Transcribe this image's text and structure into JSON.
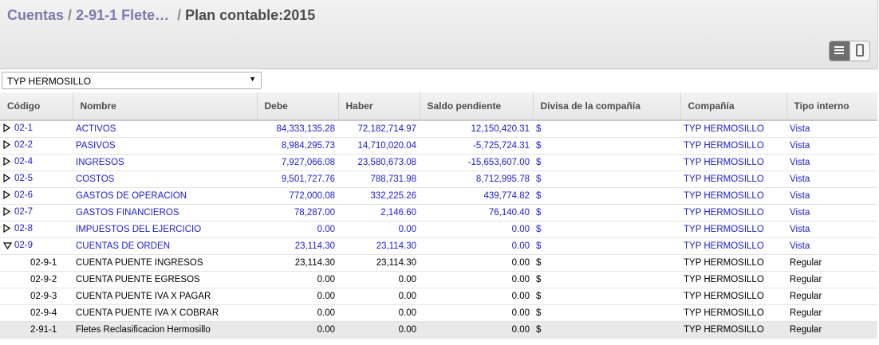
{
  "breadcrumb": {
    "item1": "Cuentas",
    "sep1": "/",
    "item2": "2-91-1 Flete…",
    "sep2": "/",
    "current": "Plan contable:2015"
  },
  "view_switch": {
    "active": "list-view-icon",
    "other": "form-view-icon"
  },
  "company_select": {
    "value": "TYP HERMOSILLO"
  },
  "columns": [
    "Código",
    "Nombre",
    "Debe",
    "Haber",
    "Saldo pendiente",
    "Divisa de la compañía",
    "Compañía",
    "Tipo interno"
  ],
  "rows": [
    {
      "code": "02-1",
      "name": "ACTIVOS",
      "debe": "84,333,135.28",
      "haber": "72,182,714.97",
      "saldo": "12,150,420.31",
      "currency": "$",
      "company": "TYP HERMOSILLO",
      "type": "Vista",
      "expander": "collapsed"
    },
    {
      "code": "02-2",
      "name": "PASIVOS",
      "debe": "8,984,295.73",
      "haber": "14,710,020.04",
      "saldo": "-5,725,724.31",
      "currency": "$",
      "company": "TYP HERMOSILLO",
      "type": "Vista",
      "expander": "collapsed"
    },
    {
      "code": "02-4",
      "name": "INGRESOS",
      "debe": "7,927,066.08",
      "haber": "23,580,673.08",
      "saldo": "-15,653,607.00",
      "currency": "$",
      "company": "TYP HERMOSILLO",
      "type": "Vista",
      "expander": "collapsed"
    },
    {
      "code": "02-5",
      "name": "COSTOS",
      "debe": "9,501,727.76",
      "haber": "788,731.98",
      "saldo": "8,712,995.78",
      "currency": "$",
      "company": "TYP HERMOSILLO",
      "type": "Vista",
      "expander": "collapsed"
    },
    {
      "code": "02-6",
      "name": "GASTOS DE OPERACION",
      "debe": "772,000.08",
      "haber": "332,225.26",
      "saldo": "439,774.82",
      "currency": "$",
      "company": "TYP HERMOSILLO",
      "type": "Vista",
      "expander": "collapsed"
    },
    {
      "code": "02-7",
      "name": "GASTOS FINANCIEROS",
      "debe": "78,287.00",
      "haber": "2,146.60",
      "saldo": "76,140.40",
      "currency": "$",
      "company": "TYP HERMOSILLO",
      "type": "Vista",
      "expander": "collapsed"
    },
    {
      "code": "02-8",
      "name": "IMPUESTOS DEL EJERCICIO",
      "debe": "0.00",
      "haber": "0.00",
      "saldo": "0.00",
      "currency": "$",
      "company": "TYP HERMOSILLO",
      "type": "Vista",
      "expander": "collapsed"
    },
    {
      "code": "02-9",
      "name": "CUENTAS DE ORDEN",
      "debe": "23,114.30",
      "haber": "23,114.30",
      "saldo": "0.00",
      "currency": "$",
      "company": "TYP HERMOSILLO",
      "type": "Vista",
      "expander": "expanded"
    },
    {
      "code": "02-9-1",
      "name": "CUENTA PUENTE INGRESOS",
      "debe": "23,114.30",
      "haber": "23,114.30",
      "saldo": "0.00",
      "currency": "$",
      "company": "TYP HERMOSILLO",
      "type": "Regular",
      "expander": "none"
    },
    {
      "code": "02-9-2",
      "name": "CUENTA PUENTE EGRESOS",
      "debe": "0.00",
      "haber": "0.00",
      "saldo": "0.00",
      "currency": "$",
      "company": "TYP HERMOSILLO",
      "type": "Regular",
      "expander": "none"
    },
    {
      "code": "02-9-3",
      "name": "CUENTA PUENTE IVA X PAGAR",
      "debe": "0.00",
      "haber": "0.00",
      "saldo": "0.00",
      "currency": "$",
      "company": "TYP HERMOSILLO",
      "type": "Regular",
      "expander": "none"
    },
    {
      "code": "02-9-4",
      "name": "CUENTA PUENTE IVA X COBRAR",
      "debe": "0.00",
      "haber": "0.00",
      "saldo": "0.00",
      "currency": "$",
      "company": "TYP HERMOSILLO",
      "type": "Regular",
      "expander": "none"
    },
    {
      "code": "2-91-1",
      "name": "Fletes Reclasificacion Hermosillo",
      "debe": "0.00",
      "haber": "0.00",
      "saldo": "0.00",
      "currency": "$",
      "company": "TYP HERMOSILLO",
      "type": "Regular",
      "expander": "none",
      "selected": true
    }
  ]
}
